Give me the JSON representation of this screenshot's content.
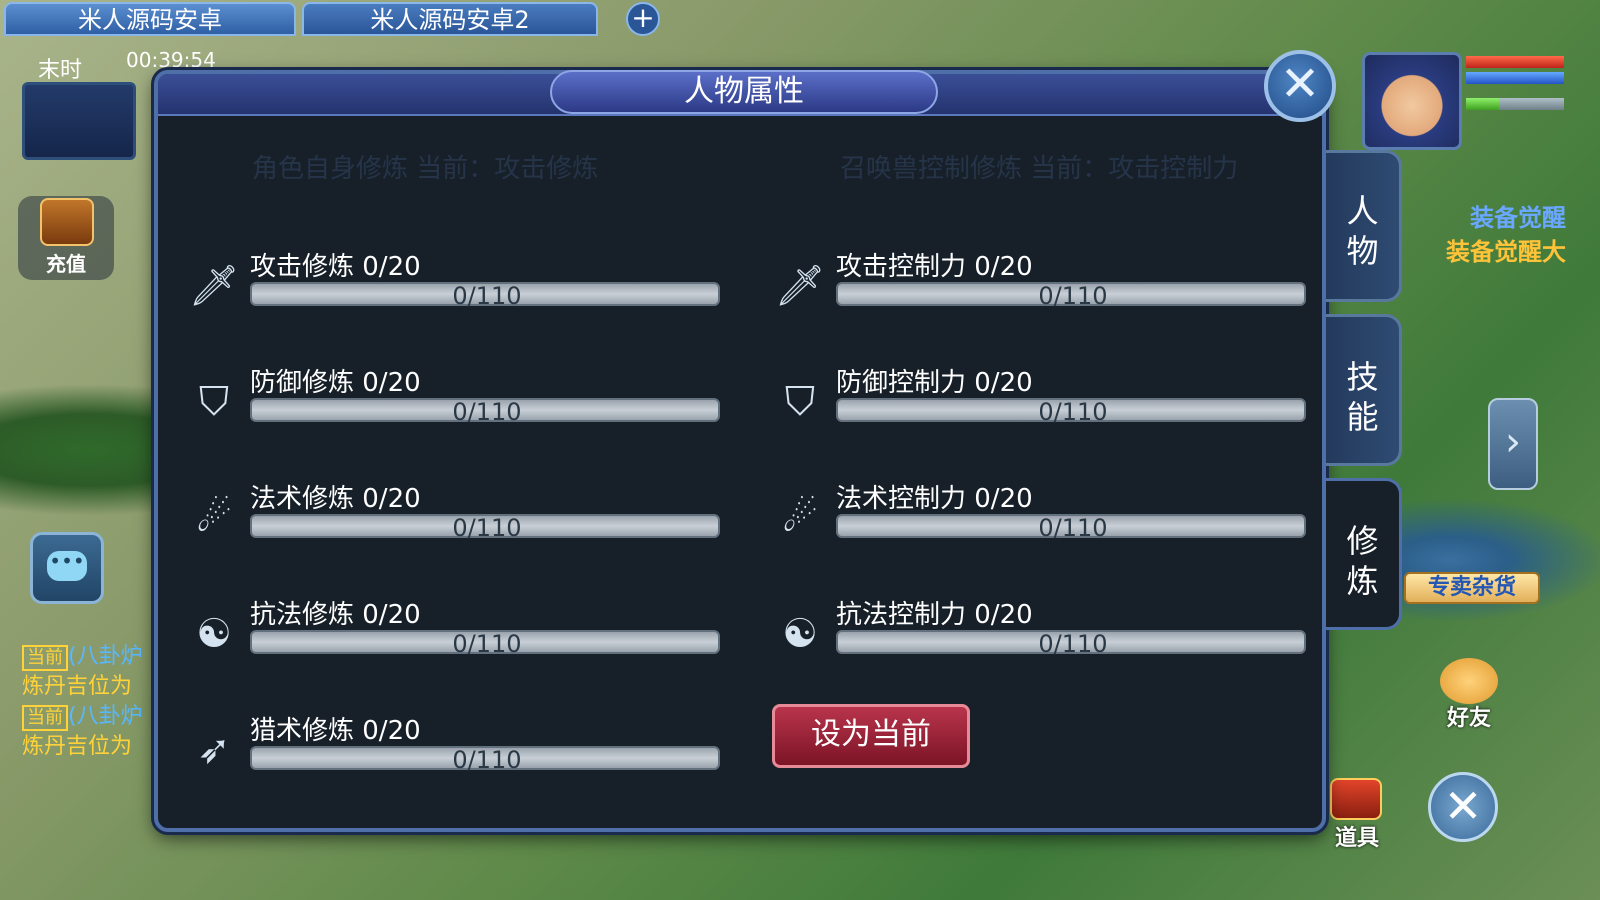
{
  "window_tabs": [
    {
      "label": "米人源码安卓"
    },
    {
      "label": "米人源码安卓2"
    }
  ],
  "add_tab_label": "+",
  "hud": {
    "time_label": "末时",
    "clock": "00:39:54",
    "recharge_label": "充值",
    "chat_lines": [
      {
        "tag": "当前",
        "channel": "(八卦炉",
        "text": "炼丹吉位为"
      },
      {
        "tag": "当前",
        "channel": "(八卦炉",
        "text": "炼丹吉位为"
      }
    ],
    "awaken_1": "装备觉醒",
    "awaken_2": "装备觉醒大",
    "shop_label": "专卖杂货",
    "friend_label": "好友",
    "items_label": "道具",
    "player_hp_fraction": 1.0,
    "player_mp_fraction": 1.0,
    "player_sp_fraction": 0.34
  },
  "panel": {
    "title": "人物属性",
    "close_symbol": "✕",
    "subheader_left": "角色自身修炼  当前：攻击修炼",
    "subheader_right": "召唤兽控制修炼  当前：攻击控制力",
    "left_rows": [
      {
        "name": "攻击修炼 0/20",
        "progress": "0/110",
        "icon": "sword-icon",
        "glyph": "🗡"
      },
      {
        "name": "防御修炼 0/20",
        "progress": "0/110",
        "icon": "shield-icon",
        "glyph": "⛉"
      },
      {
        "name": "法术修炼 0/20",
        "progress": "0/110",
        "icon": "staff-icon",
        "glyph": "☄"
      },
      {
        "name": "抗法修炼 0/20",
        "progress": "0/110",
        "icon": "yin-yang-icon",
        "glyph": "☯"
      },
      {
        "name": "猎术修炼 0/20",
        "progress": "0/110",
        "icon": "bow-icon",
        "glyph": "➶"
      }
    ],
    "right_rows": [
      {
        "name": "攻击控制力 0/20",
        "progress": "0/110",
        "icon": "sword-icon",
        "glyph": "🗡"
      },
      {
        "name": "防御控制力 0/20",
        "progress": "0/110",
        "icon": "shield-icon",
        "glyph": "⛉"
      },
      {
        "name": "法术控制力 0/20",
        "progress": "0/110",
        "icon": "staff-icon",
        "glyph": "☄"
      },
      {
        "name": "抗法控制力 0/20",
        "progress": "0/110",
        "icon": "yin-yang-icon",
        "glyph": "☯"
      }
    ],
    "set_current_label": "设为当前",
    "side_tabs": [
      {
        "label": "人\n物"
      },
      {
        "label": "技\n能"
      },
      {
        "label": "修\n炼"
      }
    ]
  },
  "colors": {
    "panel_bg": "#172029",
    "panel_border": "#4f6fa8",
    "button_red": "#9a2038",
    "bar_gray": "#b2bac2"
  }
}
